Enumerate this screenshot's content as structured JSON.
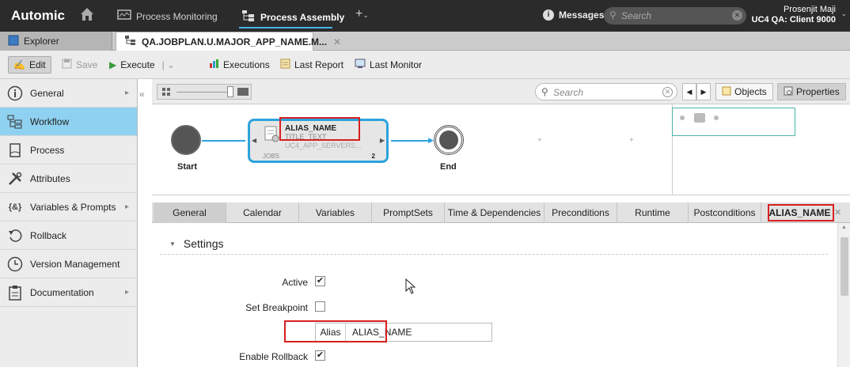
{
  "app": {
    "logo": "Automic"
  },
  "topnav": [
    {
      "label": "Process Monitoring",
      "icon": "monitor-icon"
    },
    {
      "label": "Process Assembly",
      "icon": "process-assembly-icon"
    }
  ],
  "topbar": {
    "plus": "+",
    "messages": "Messages",
    "search_placeholder": "Search",
    "user_name": "Prosenjit Maji",
    "client": "UC4 QA: Client 9000"
  },
  "tabs": {
    "explorer": "Explorer",
    "object": "QA.JOBPLAN.U.MAJOR_APP_NAME.M..."
  },
  "toolbar": {
    "edit": "Edit",
    "save": "Save",
    "execute": "Execute",
    "executions": "Executions",
    "last_report": "Last Report",
    "last_monitor": "Last Monitor"
  },
  "sidebar": {
    "items": [
      {
        "label": "General",
        "icon": "info-icon",
        "has_submenu": true
      },
      {
        "label": "Workflow",
        "icon": "workflow-icon",
        "active": true
      },
      {
        "label": "Process",
        "icon": "document-icon"
      },
      {
        "label": "Attributes",
        "icon": "tools-icon"
      },
      {
        "label": "Variables & Prompts",
        "icon": "variables-icon",
        "has_submenu": true
      },
      {
        "label": "Rollback",
        "icon": "rollback-icon"
      },
      {
        "label": "Version Management",
        "icon": "clock-icon"
      },
      {
        "label": "Documentation",
        "icon": "clipboard-icon",
        "has_submenu": true
      }
    ]
  },
  "workflow_toolbar": {
    "search_placeholder": "Search",
    "objects": "Objects",
    "properties": "Properties"
  },
  "canvas": {
    "start": "Start",
    "end": "End",
    "job": {
      "alias": "ALIAS_NAME",
      "title": "TITLE_TEXT",
      "agent": "UC4_APP_SERVERS...",
      "type": "JOBS",
      "count": "2"
    }
  },
  "property_tabs": [
    "General",
    "Calendar",
    "Variables",
    "PromptSets",
    "Time & Dependencies",
    "Preconditions",
    "Runtime",
    "Postconditions",
    "ALIAS_NAME"
  ],
  "settings": {
    "heading": "Settings",
    "active_label": "Active",
    "active_checked": true,
    "breakpoint_label": "Set Breakpoint",
    "breakpoint_checked": false,
    "alias_label": "Alias",
    "alias_value": "ALIAS_NAME",
    "rollback_label": "Enable Rollback",
    "rollback_checked": true
  },
  "colors": {
    "accent": "#2ba3dd",
    "highlight": "#d62020",
    "active_sidebar": "#8fd1f0",
    "topbar": "#2b2b2b"
  }
}
